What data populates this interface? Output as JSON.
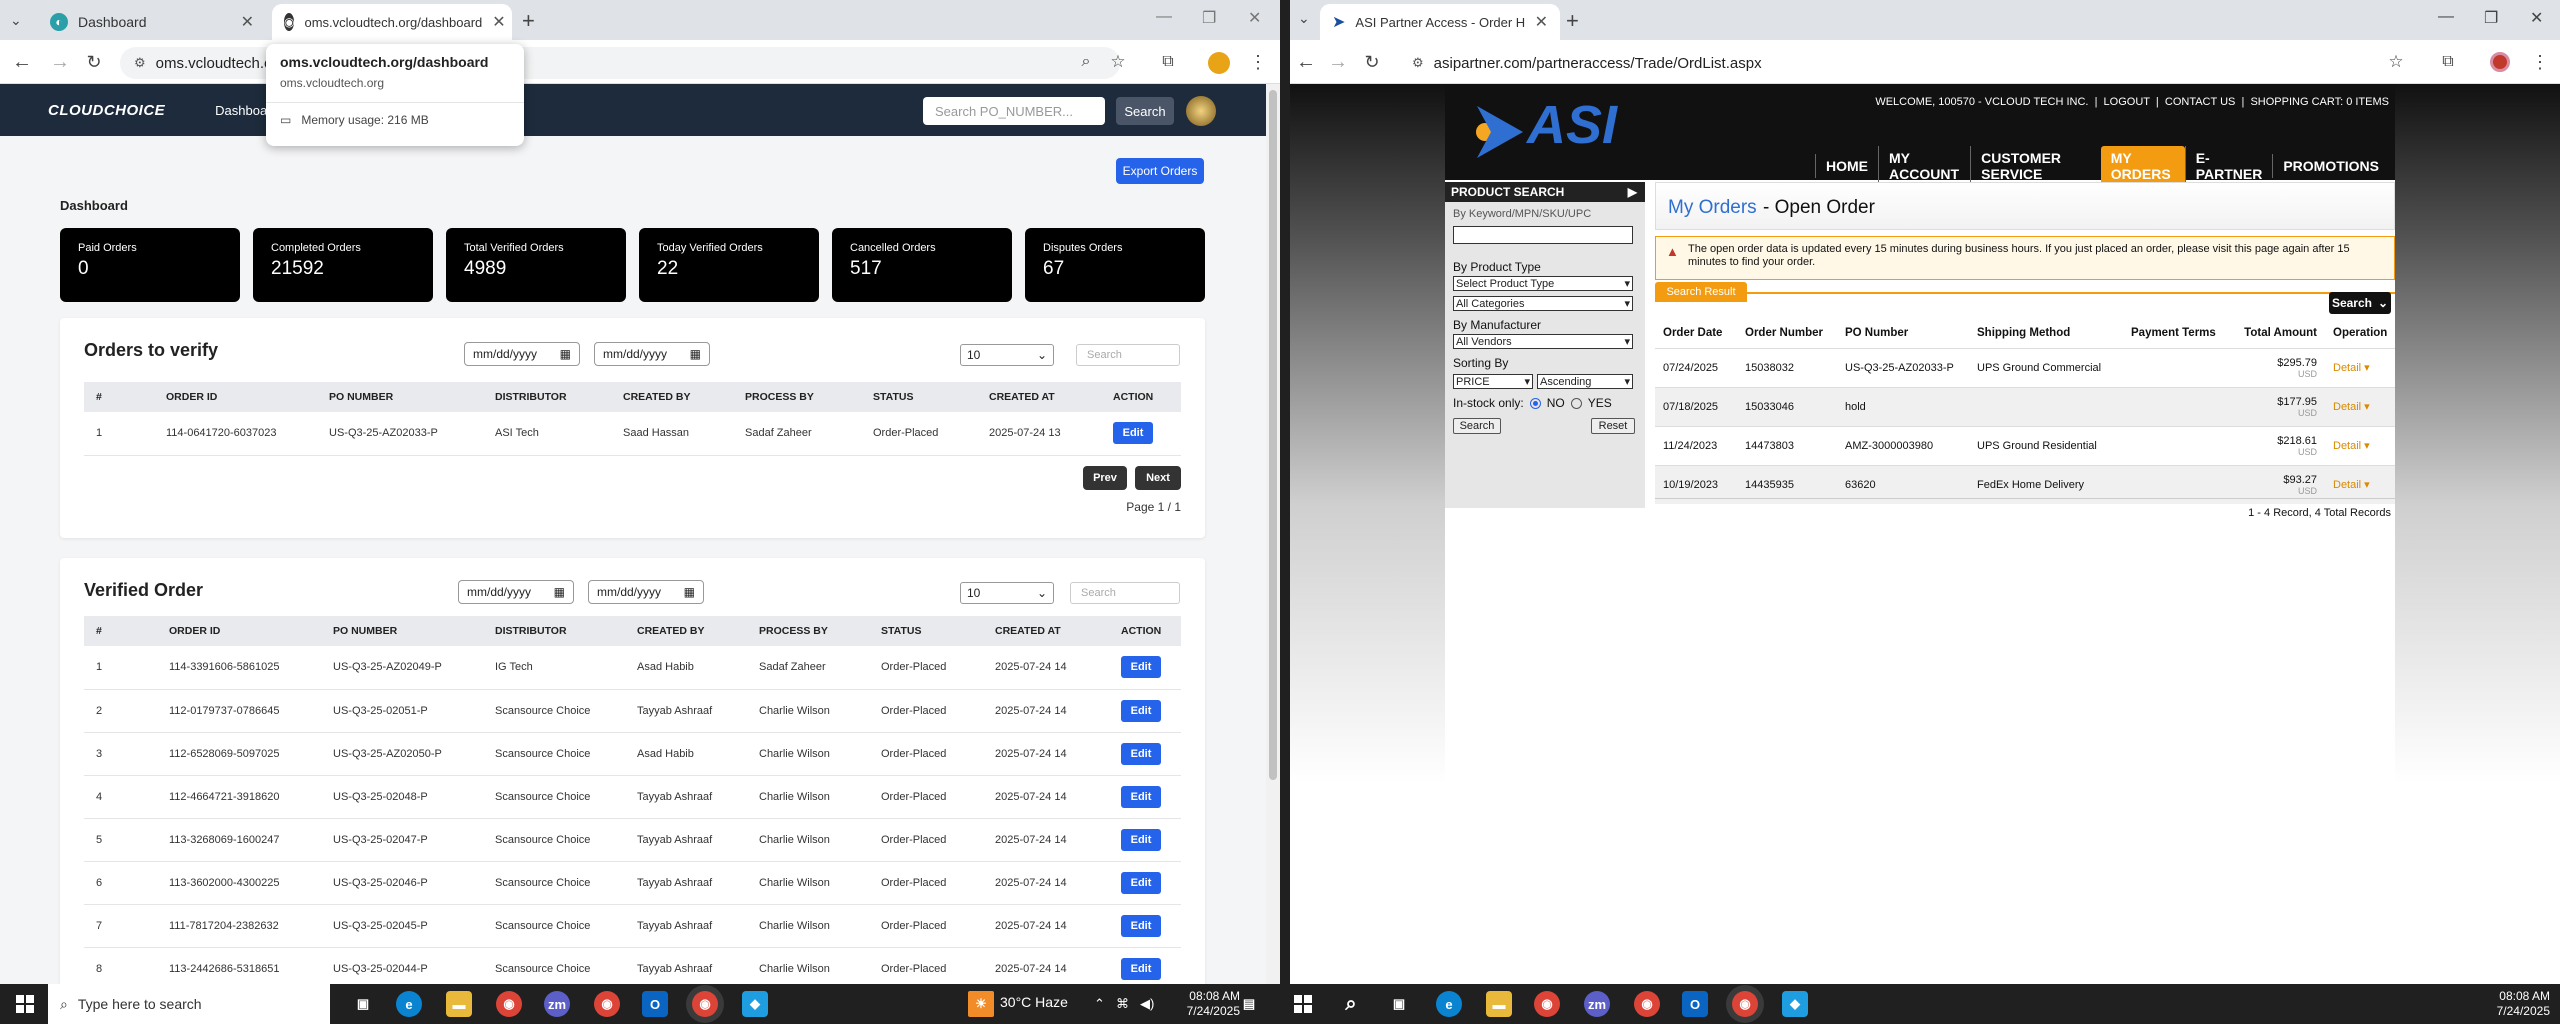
{
  "left_browser": {
    "tabs": [
      {
        "label": "Dashboard"
      },
      {
        "label": "oms.vcloudtech.org/dashboard"
      }
    ],
    "url": "oms.vcloudtech.o",
    "tab_popup": {
      "title": "oms.vcloudtech.org/dashboard",
      "domain": "oms.vcloudtech.org",
      "memory": "Memory usage: 216 MB"
    },
    "app": {
      "logo": "CLOUDCHOICE",
      "nav_dashboard": "Dashboard",
      "search_placeholder": "Search PO_NUMBER...",
      "search_button": "Search",
      "export_button": "Export Orders",
      "page_title": "Dashboard",
      "cards": [
        {
          "title": "Paid Orders",
          "value": "0"
        },
        {
          "title": "Completed Orders",
          "value": "21592"
        },
        {
          "title": "Total Verified Orders",
          "value": "4989"
        },
        {
          "title": "Today Verified Orders",
          "value": "22"
        },
        {
          "title": "Cancelled Orders",
          "value": "517"
        },
        {
          "title": "Disputes Orders",
          "value": "67"
        }
      ],
      "date_placeholder": "mm/dd/yyyy",
      "page_size": "10",
      "search_small": "Search",
      "columns": [
        "#",
        "ORDER ID",
        "PO NUMBER",
        "DISTRIBUTOR",
        "CREATED BY",
        "PROCESS BY",
        "STATUS",
        "CREATED AT",
        "ACTION"
      ],
      "edit_label": "Edit",
      "verify": {
        "title": "Orders to verify",
        "rows": [
          [
            "1",
            "114-0641720-6037023",
            "US-Q3-25-AZ02033-P",
            "ASI Tech",
            "Saad Hassan",
            "Sadaf Zaheer",
            "Order-Placed",
            "2025-07-24 13"
          ]
        ],
        "prev": "Prev",
        "next": "Next",
        "page_info": "Page 1 / 1"
      },
      "verified": {
        "title": "Verified Order",
        "rows": [
          [
            "1",
            "114-3391606-5861025",
            "US-Q3-25-AZ02049-P",
            "IG Tech",
            "Asad Habib",
            "Sadaf Zaheer",
            "Order-Placed",
            "2025-07-24 14"
          ],
          [
            "2",
            "112-0179737-0786645",
            "US-Q3-25-02051-P",
            "Scansource Choice",
            "Tayyab Ashraaf",
            "Charlie Wilson",
            "Order-Placed",
            "2025-07-24 14"
          ],
          [
            "3",
            "112-6528069-5097025",
            "US-Q3-25-AZ02050-P",
            "Scansource Choice",
            "Asad Habib",
            "Charlie Wilson",
            "Order-Placed",
            "2025-07-24 14"
          ],
          [
            "4",
            "112-4664721-3918620",
            "US-Q3-25-02048-P",
            "Scansource Choice",
            "Tayyab Ashraaf",
            "Charlie Wilson",
            "Order-Placed",
            "2025-07-24 14"
          ],
          [
            "5",
            "113-3268069-1600247",
            "US-Q3-25-02047-P",
            "Scansource Choice",
            "Tayyab Ashraaf",
            "Charlie Wilson",
            "Order-Placed",
            "2025-07-24 14"
          ],
          [
            "6",
            "113-3602000-4300225",
            "US-Q3-25-02046-P",
            "Scansource Choice",
            "Tayyab Ashraaf",
            "Charlie Wilson",
            "Order-Placed",
            "2025-07-24 14"
          ],
          [
            "7",
            "111-7817204-2382632",
            "US-Q3-25-02045-P",
            "Scansource Choice",
            "Tayyab Ashraaf",
            "Charlie Wilson",
            "Order-Placed",
            "2025-07-24 14"
          ],
          [
            "8",
            "113-2442686-5318651",
            "US-Q3-25-02044-P",
            "Scansource Choice",
            "Tayyab Ashraaf",
            "Charlie Wilson",
            "Order-Placed",
            "2025-07-24 14"
          ]
        ]
      }
    }
  },
  "right_browser": {
    "tab_label": "ASI Partner Access - Order Hist",
    "url": "asipartner.com/partneraccess/Trade/OrdList.aspx",
    "asi": {
      "logo": "ASI",
      "top_links": "WELCOME, 100570 - VCLOUD TECH INC.  |  LOGOUT  |  CONTACT US  |  SHOPPING CART: 0 ITEMS",
      "nav": [
        "HOME",
        "MY ACCOUNT",
        "CUSTOMER SERVICE",
        "MY ORDERS",
        "E-PARTNER",
        "PROMOTIONS"
      ],
      "product_search": "PRODUCT SEARCH",
      "keyword_label": "By Keyword/MPN/SKU/UPC",
      "product_type_label": "By Product Type",
      "product_type_select": "Select Product Type",
      "category_select": "All Categories",
      "manufacturer_label": "By Manufacturer",
      "vendor_select": "All Vendors",
      "sorting_label": "Sorting By",
      "sort_field": "PRICE",
      "sort_order": "Ascending",
      "instock_label": "In-stock only:",
      "instock_no": "NO",
      "instock_yes": "YES",
      "search_btn": "Search",
      "reset_btn": "Reset",
      "title_prefix": "My Orders",
      "title_suffix": " - Open Order",
      "notice": "The open order data is updated every 15 minutes during business hours. If you just placed an order, please visit this page again after 15 minutes to find your order.",
      "search_result_tab": "Search Result",
      "search_dropdown": "Search",
      "columns": [
        "Order Date",
        "Order Number",
        "PO Number",
        "Shipping Method",
        "Payment Terms",
        "Total Amount",
        "Operation"
      ],
      "rows": [
        {
          "date": "07/24/2025",
          "num": "15038032",
          "po": "US-Q3-25-AZ02033-P",
          "ship": "UPS Ground Commercial",
          "terms": "",
          "amount": "$295.79",
          "cur": "USD",
          "op": "Detail"
        },
        {
          "date": "07/18/2025",
          "num": "15033046",
          "po": "hold",
          "ship": "",
          "terms": "",
          "amount": "$177.95",
          "cur": "USD",
          "op": "Detail"
        },
        {
          "date": "11/24/2023",
          "num": "14473803",
          "po": "AMZ-3000003980",
          "ship": "UPS Ground Residential",
          "terms": "",
          "amount": "$218.61",
          "cur": "USD",
          "op": "Detail"
        },
        {
          "date": "10/19/2023",
          "num": "14435935",
          "po": "63620",
          "ship": "FedEx Home Delivery",
          "terms": "",
          "amount": "$93.27",
          "cur": "USD",
          "op": "Detail"
        }
      ],
      "records": "1 - 4 Record,  4 Total Records"
    }
  },
  "taskbar": {
    "search_placeholder": "Type here to search",
    "weather": "30°C  Haze",
    "time_left": "08:08 AM",
    "date_left": "7/24/2025",
    "time_right": "08:08 AM",
    "date_right": "7/24/2025"
  },
  "colors": {
    "accent_blue": "#2563eb",
    "nav_dark": "#1d2b3c",
    "asi_orange": "#f39c12"
  }
}
